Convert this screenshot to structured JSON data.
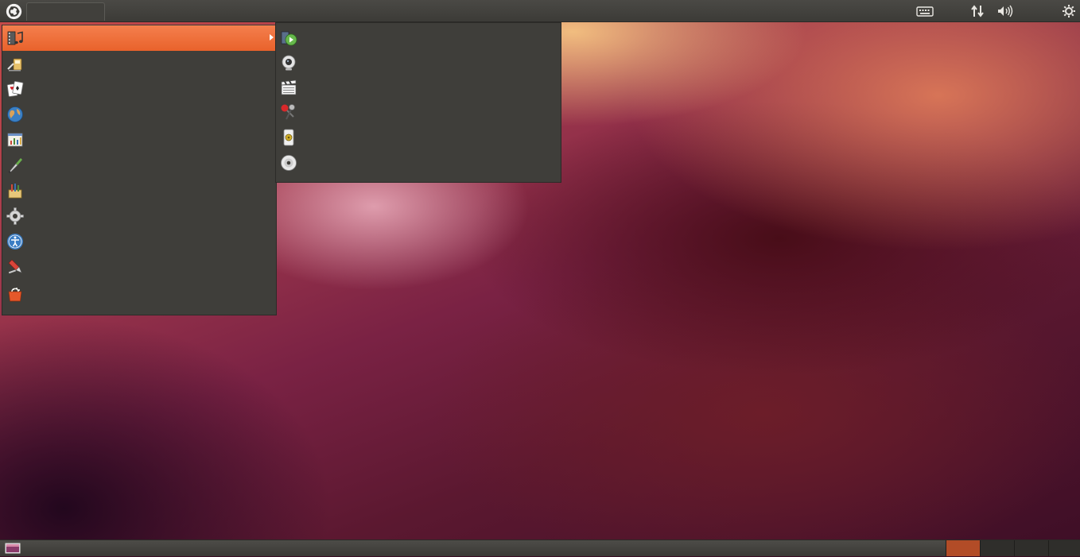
{
  "top_panel": {
    "menu_button_icon": "ubuntu-logo-icon",
    "tray_icons": [
      "keyboard-icon",
      "network-icon",
      "volume-icon",
      "session-gear-icon"
    ]
  },
  "applications_menu": {
    "items": [
      {
        "icon": "sound-video-icon",
        "active": true,
        "has_submenu": true
      },
      {
        "icon": "accessories-icon"
      },
      {
        "icon": "games-icon"
      },
      {
        "icon": "internet-globe-icon"
      },
      {
        "icon": "office-icon"
      },
      {
        "icon": "graphics-icon"
      },
      {
        "icon": "other-icon"
      },
      {
        "icon": "system-settings-gear-icon"
      },
      {
        "icon": "universal-access-icon"
      },
      {
        "icon": "system-tools-icon"
      },
      {
        "icon": "software-center-icon"
      }
    ]
  },
  "submenu": {
    "items": [
      {
        "icon": "video-player-icon"
      },
      {
        "icon": "webcam-icon"
      },
      {
        "icon": "movie-editor-icon"
      },
      {
        "icon": "sound-recorder-icon"
      },
      {
        "icon": "music-player-icon"
      },
      {
        "icon": "disc-burner-icon"
      }
    ]
  },
  "bottom_panel": {
    "show_desktop_icon": "show-desktop-icon",
    "workspaces": [
      {
        "active": true
      },
      {
        "active": false
      },
      {
        "active": false
      },
      {
        "active": false
      }
    ]
  },
  "colors": {
    "panel": "#3c3b37",
    "menu_bg": "#3f3e3a",
    "highlight": "#e9622b",
    "workspace_active": "#b24c27"
  }
}
